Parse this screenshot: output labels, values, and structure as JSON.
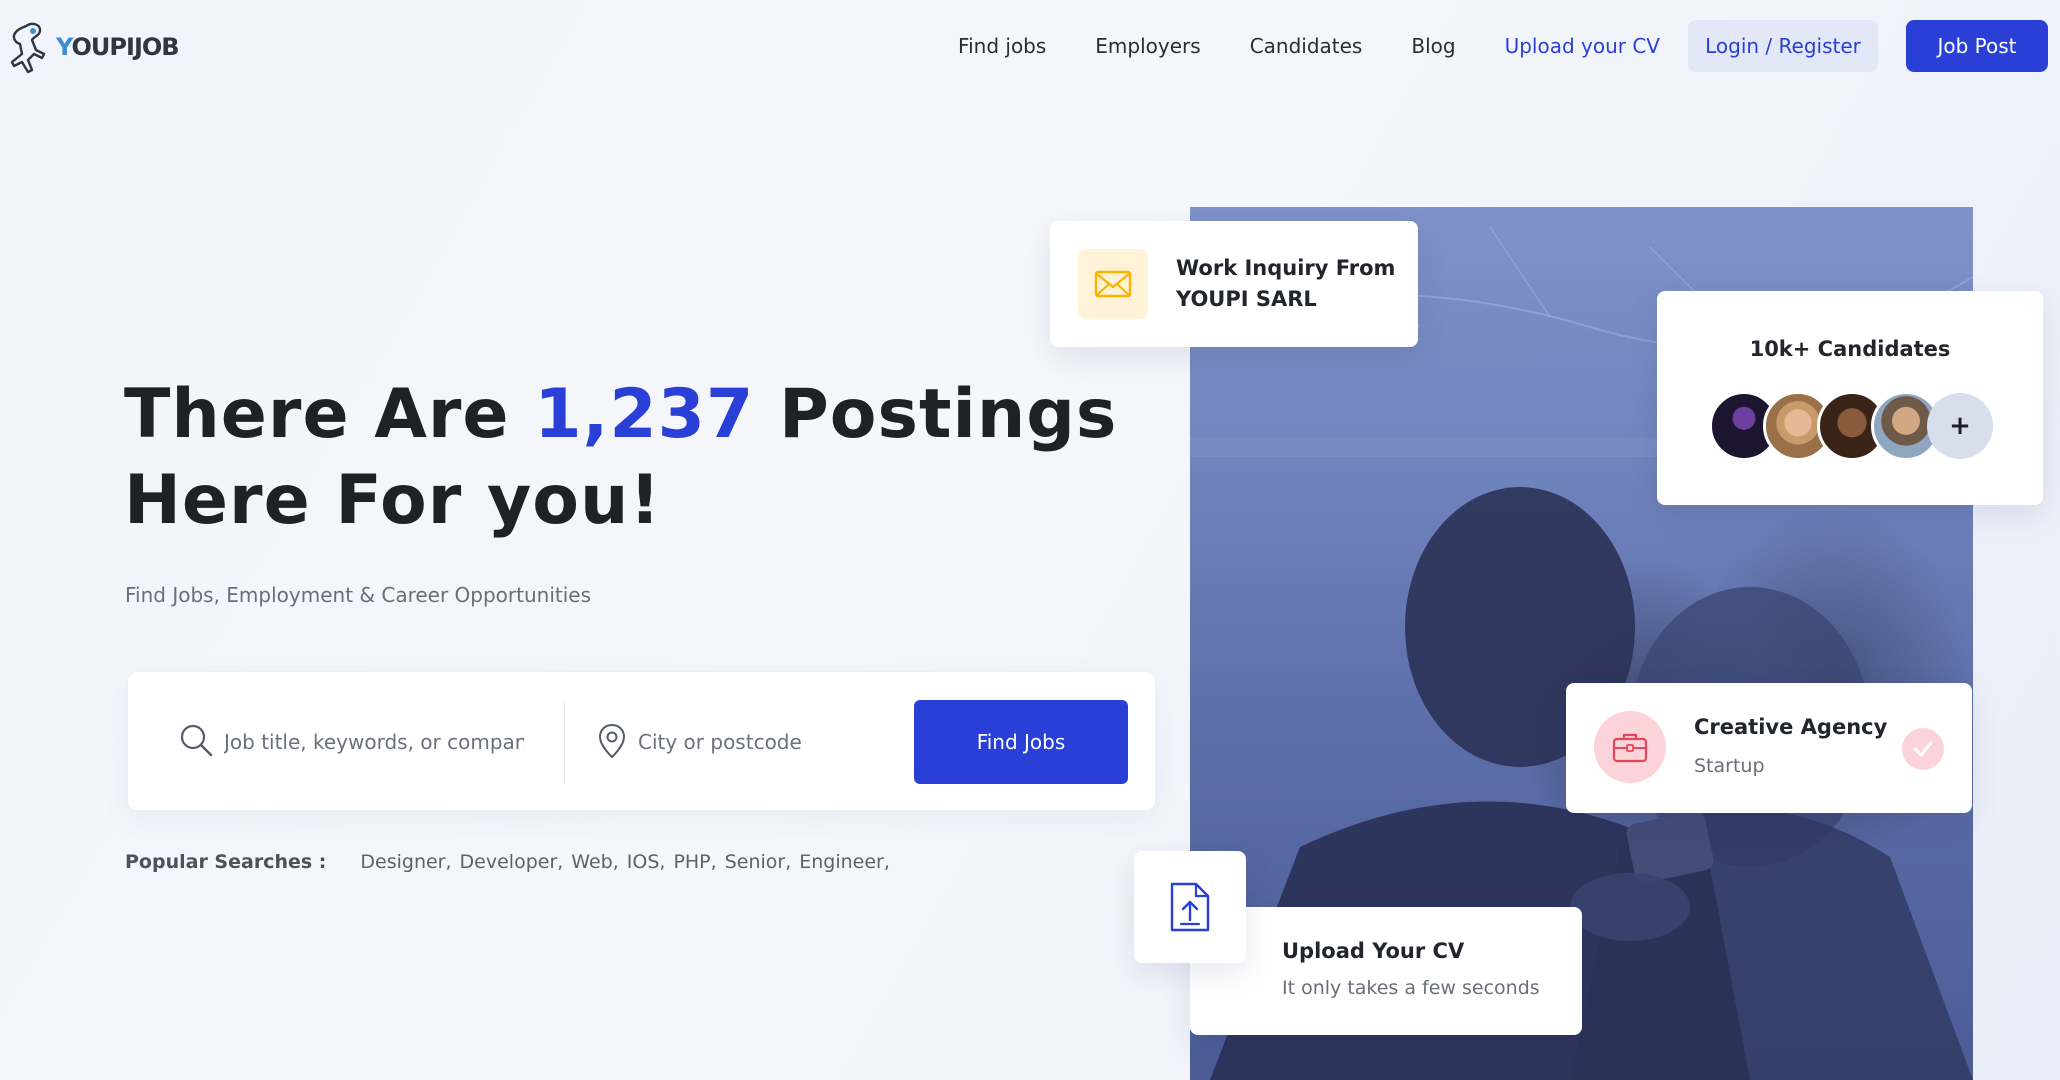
{
  "brand": {
    "name_prefix": "Y",
    "name_rest": "OUPIJOB"
  },
  "nav": {
    "links": [
      "Find jobs",
      "Employers",
      "Candidates",
      "Blog"
    ],
    "upload_cv": "Upload your CV",
    "login": "Login / Register",
    "job_post": "Job Post"
  },
  "hero": {
    "title_before": "There Are ",
    "title_count": "1,237",
    "title_after": " Postings Here For you!",
    "subtitle": "Find Jobs, Employment & Career Opportunities"
  },
  "search": {
    "keyword_placeholder": "Job title, keywords, or company",
    "location_placeholder": "City or postcode",
    "button": "Find Jobs"
  },
  "popular": {
    "label": "Popular Searches :",
    "tags": [
      "Designer,",
      "Developer,",
      "Web,",
      "IOS,",
      "PHP,",
      "Senior,",
      "Engineer,"
    ]
  },
  "cards": {
    "inquiry": {
      "line1": "Work Inquiry From",
      "line2": "YOUPI SARL",
      "icon": "envelope-icon"
    },
    "candidates": {
      "title": "10k+ Candidates",
      "more": "+"
    },
    "agency": {
      "title": "Creative Agency",
      "subtitle": "Startup",
      "icon": "briefcase-icon"
    },
    "upload": {
      "title": "Upload Your CV",
      "subtitle": "It only takes a few seconds",
      "icon": "file-upload-icon"
    }
  },
  "colors": {
    "accent": "#2a3fd6",
    "accent_light": "#e2e8f8",
    "inquiry_bg": "#fff2d6",
    "agency_bg": "#fbd3d8"
  }
}
